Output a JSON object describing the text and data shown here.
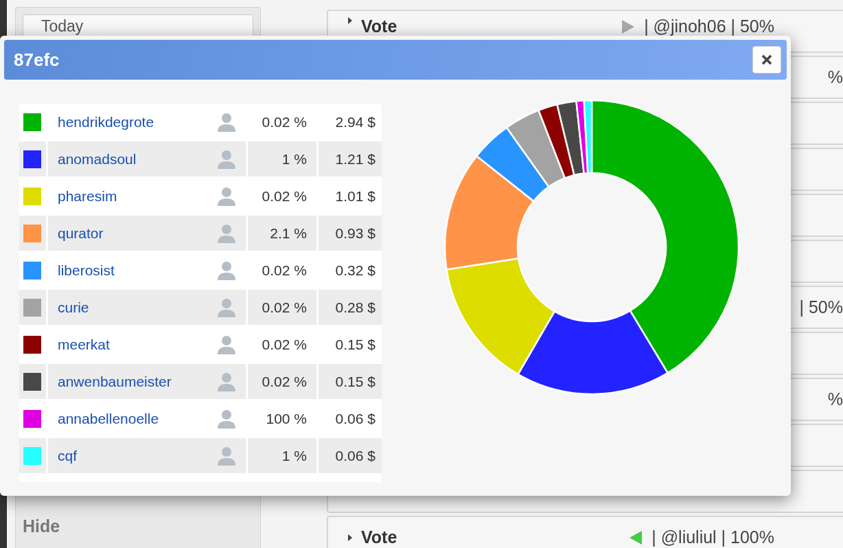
{
  "sidebar": {
    "date_field": "Today",
    "hide_label": "Hide"
  },
  "votes": [
    {
      "kind": "full",
      "title": "Vote",
      "pointing_left": false,
      "color": "#aaaaaa",
      "voter": "| @jinoh06 | 50%"
    },
    {
      "kind": "fragment",
      "text": "%"
    },
    {
      "kind": "blank"
    },
    {
      "kind": "blank"
    },
    {
      "kind": "blank"
    },
    {
      "kind": "blank"
    },
    {
      "kind": "fragment",
      "text": "| 50%"
    },
    {
      "kind": "blank"
    },
    {
      "kind": "fragment",
      "text": "%"
    },
    {
      "kind": "blank"
    },
    {
      "kind": "blank"
    },
    {
      "kind": "full",
      "title": "Vote",
      "pointing_left": true,
      "color": "#44cc44",
      "voter": "| @liuliul | 100%"
    }
  ],
  "dialog": {
    "title": "87efc",
    "rows": [
      {
        "color": "#00b300",
        "name": "hendrikdegrote",
        "percent": "0.02 %",
        "amount": "2.94 $"
      },
      {
        "color": "#2323ff",
        "name": "anomadsoul",
        "percent": "1 %",
        "amount": "1.21 $"
      },
      {
        "color": "#dddd00",
        "name": "pharesim",
        "percent": "0.02 %",
        "amount": "1.01 $"
      },
      {
        "color": "#ff9347",
        "name": "qurator",
        "percent": "2.1 %",
        "amount": "0.93 $"
      },
      {
        "color": "#2894ff",
        "name": "liberosist",
        "percent": "0.02 %",
        "amount": "0.32 $"
      },
      {
        "color": "#a3a3a3",
        "name": "curie",
        "percent": "0.02 %",
        "amount": "0.28 $"
      },
      {
        "color": "#8c0000",
        "name": "meerkat",
        "percent": "0.02 %",
        "amount": "0.15 $"
      },
      {
        "color": "#484848",
        "name": "anwenbaumeister",
        "percent": "0.02 %",
        "amount": "0.15 $"
      },
      {
        "color": "#e100e1",
        "name": "annabellenoelle",
        "percent": "100 %",
        "amount": "0.06 $"
      },
      {
        "color": "#25ffff",
        "name": "cqf",
        "percent": "1 %",
        "amount": "0.06 $"
      }
    ],
    "chart_data": {
      "type": "donut",
      "values": [
        41.35,
        17.02,
        14.21,
        13.08,
        4.5,
        3.94,
        2.11,
        2.11,
        0.84,
        0.84
      ]
    }
  }
}
